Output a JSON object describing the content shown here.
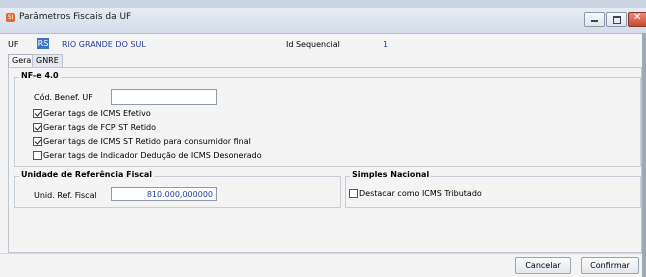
{
  "window": {
    "title": "Parâmetros Fiscais da UF",
    "app_icon": "SI",
    "controls": [
      "minimize-icon",
      "maximize-icon",
      "close-icon"
    ]
  },
  "header": {
    "uf_label": "UF",
    "uf_code": "RS",
    "uf_name": "RIO GRANDE DO SUL",
    "id_label": "Id Sequencial",
    "id_value": "1"
  },
  "tabs": [
    {
      "label": "Geral",
      "active": true
    },
    {
      "label": "GNRE",
      "active": false
    }
  ],
  "nfe": {
    "title": "NF-e 4.0",
    "cod_label": "Cód. Benef. UF",
    "cod_value": "",
    "checkboxes": [
      {
        "label": "Gerar tags de ICMS Efetivo",
        "checked": true
      },
      {
        "label": "Gerar tags de FCP ST Retido",
        "checked": true
      },
      {
        "label": "Gerar tags de ICMS ST Retido para consumidor final",
        "checked": true
      },
      {
        "label": "Gerar tags de Indicador Dedução de ICMS Desonerado",
        "checked": false
      }
    ]
  },
  "unidade": {
    "title": "Unidade de Referência Fiscal",
    "label": "Unid. Ref. Fiscal",
    "value": "810.000,000000"
  },
  "simples": {
    "title": "Simples Nacional",
    "checkbox_label": "Destacar como ICMS Tributado",
    "checked": false
  },
  "footer": {
    "cancel": "Cancelar",
    "confirm": "Confirmar"
  },
  "colors": {
    "accent": "#3d73c4",
    "value_text": "#1f3aa8",
    "close_button": "#c84a31"
  }
}
